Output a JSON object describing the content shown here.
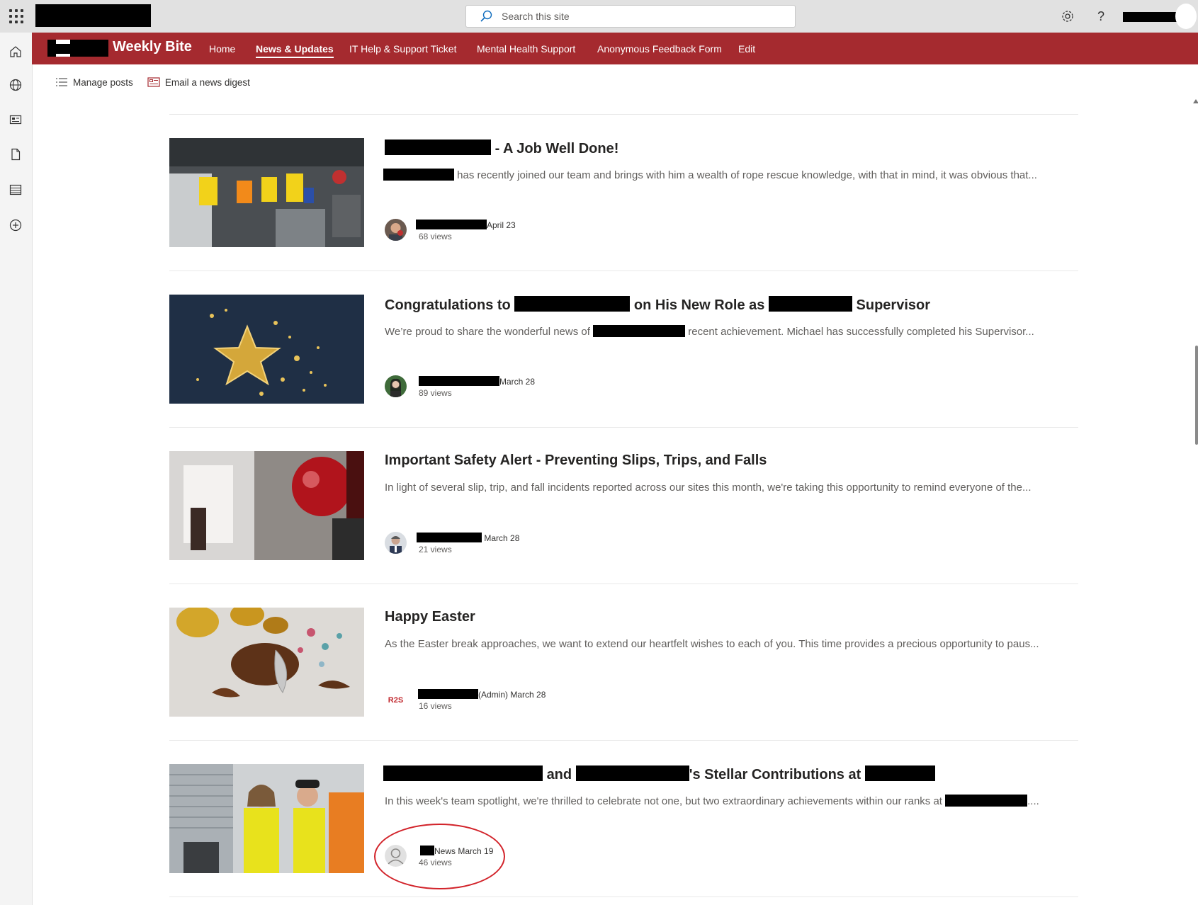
{
  "search": {
    "placeholder": "Search this site"
  },
  "site": {
    "title": "Weekly Bite"
  },
  "nav": [
    {
      "label": "Home"
    },
    {
      "label": "News & Updates",
      "active": true
    },
    {
      "label": "IT Help & Support Ticket"
    },
    {
      "label": "Mental Health Support"
    },
    {
      "label": "Anonymous Feedback Form"
    },
    {
      "label": "Edit"
    }
  ],
  "commands": {
    "manage_posts": "Manage posts",
    "email_digest": "Email a news digest"
  },
  "posts": [
    {
      "title_suffix": "- A Job Well Done!",
      "desc": "has recently joined our team and brings with him a wealth of rope rescue knowledge, with that in mind, it was obvious that...",
      "date": "April 23",
      "views": "68 views"
    },
    {
      "title_part1": "Congratulations to",
      "title_part2": "on His New Role as",
      "title_part3": "Supervisor",
      "desc_part1": "We’re proud to share the wonderful news of",
      "desc_part2": "recent achievement. Michael has successfully completed his Supervisor...",
      "date": "March 28",
      "views": "89 views"
    },
    {
      "title": "Important Safety Alert - Preventing Slips, Trips, and Falls",
      "desc": "In light of several slip, trip, and fall incidents reported across our sites this month, we're taking this opportunity to remind everyone of the...",
      "date": "March 28",
      "views": "21 views"
    },
    {
      "title": "Happy Easter",
      "desc": "As the Easter break approaches, we want to extend our heartfelt wishes to each of you. This time provides a precious opportunity to paus...",
      "author_suffix": "(Admin)",
      "avatar_text": "R2S",
      "date": "March 28",
      "views": "16 views"
    },
    {
      "title_part1": "and",
      "title_part2": "'s Stellar Contributions at",
      "desc": "In this week's team spotlight, we're thrilled to celebrate not one, but two extraordinary achievements within our ranks at",
      "desc_end": "....",
      "author_suffix": "News",
      "date": "March 19",
      "views": "46 views"
    }
  ],
  "colors": {
    "suite_bar": "#e1e1e1",
    "site_bar": "#a52a2f",
    "annotation": "#d2232a"
  },
  "icons": [
    "waffle-icon",
    "search-icon",
    "gear-icon",
    "help-icon",
    "home-icon",
    "globe-icon",
    "news-icon",
    "file-icon",
    "list-icon",
    "add-icon"
  ]
}
